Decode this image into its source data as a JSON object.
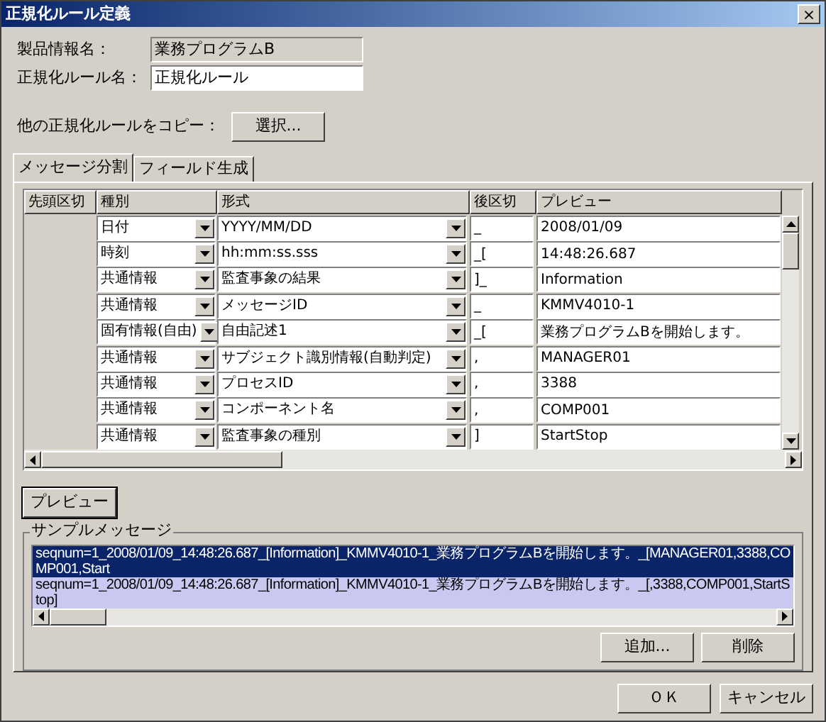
{
  "window": {
    "title": "正規化ルール定義",
    "close": "×"
  },
  "fields": [
    {
      "label": "製品情報名：",
      "value": "業務プログラムB",
      "disabled": true
    },
    {
      "label": "正規化ルール名：",
      "value": "正規化ルール",
      "disabled": false
    }
  ],
  "copy": {
    "label": "他の正規化ルールをコピー：",
    "button": "選択..."
  },
  "tabs": [
    {
      "label": "メッセージ分割",
      "selected": true
    },
    {
      "label": "フィールド生成",
      "selected": false
    }
  ],
  "table": {
    "columns": [
      "先頭区切",
      "種別",
      "形式",
      "後区切",
      "プレビュー"
    ],
    "rows": [
      {
        "type": "日付",
        "format": "YYYY/MM/DD",
        "after": "_",
        "preview": "2008/01/09"
      },
      {
        "type": "時刻",
        "format": "hh:mm:ss.sss",
        "after": "_[",
        "preview": "14:48:26.687"
      },
      {
        "type": "共通情報",
        "format": "監査事象の結果",
        "after": "]_",
        "preview": "Information"
      },
      {
        "type": "共通情報",
        "format": "メッセージID",
        "after": "_",
        "preview": "KMMV4010-1"
      },
      {
        "type": "固有情報(自由)",
        "format": "自由記述1",
        "after": "_[",
        "preview": "業務プログラムBを開始します。"
      },
      {
        "type": "共通情報",
        "format": "サブジェクト識別情報(自動判定)",
        "after": ",",
        "preview": "MANAGER01"
      },
      {
        "type": "共通情報",
        "format": "プロセスID",
        "after": ",",
        "preview": "3388"
      },
      {
        "type": "共通情報",
        "format": "コンポーネント名",
        "after": ",",
        "preview": "COMP001"
      },
      {
        "type": "共通情報",
        "format": "監査事象の種別",
        "after": "]",
        "preview": "StartStop"
      }
    ]
  },
  "preview_button": "プレビュー",
  "sample": {
    "title": "サンプルメッセージ",
    "messages": [
      {
        "text": "seqnum=1_2008/01/09_14:48:26.687_[Information]_KMMV4010-1_業務プログラムBを開始します。_[MANAGER01,3388,COMP001,Start",
        "selected": true,
        "highlighted": false
      },
      {
        "text": "seqnum=1_2008/01/09_14:48:26.687_[Information]_KMMV4010-1_業務プログラムBを開始します。_[,3388,COMP001,StartStop]",
        "selected": false,
        "highlighted": true
      }
    ],
    "buttons": [
      "追加...",
      "削除"
    ]
  },
  "buttons": [
    "ＯＫ",
    "キャンセル"
  ]
}
